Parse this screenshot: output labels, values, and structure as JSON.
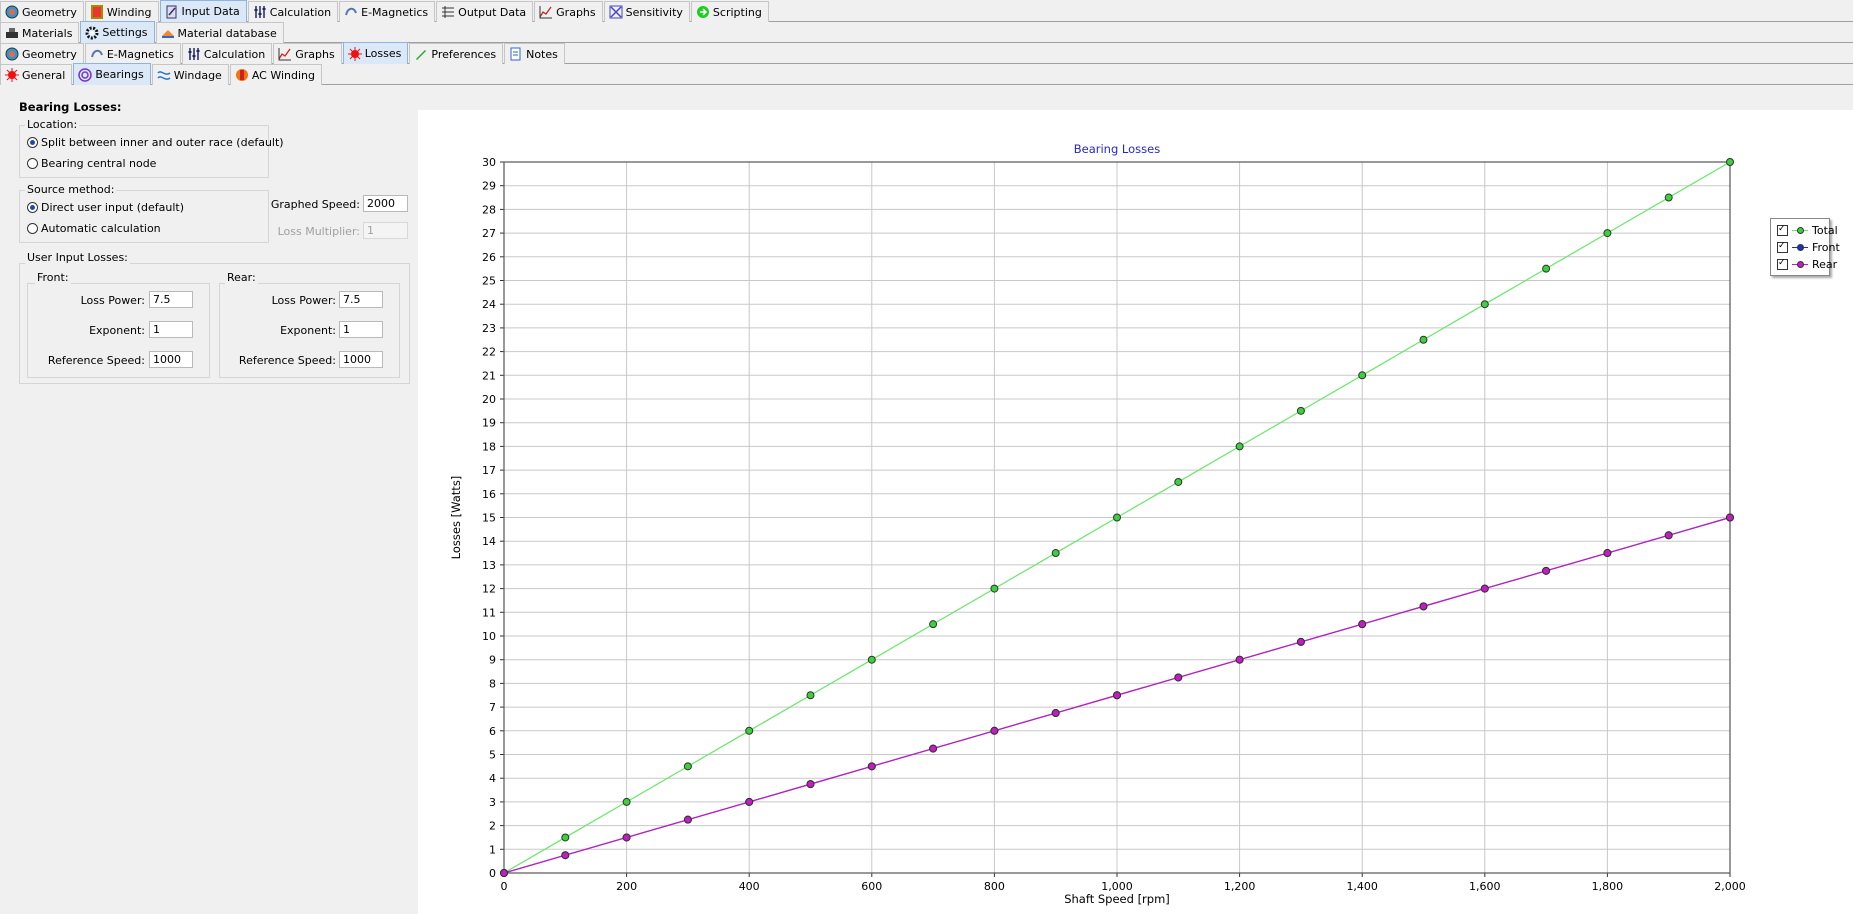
{
  "main_tabs": [
    {
      "label": "Geometry",
      "icon": "geometry-icon",
      "selected": false
    },
    {
      "label": "Winding",
      "icon": "winding-icon",
      "selected": false
    },
    {
      "label": "Input Data",
      "icon": "input-data-icon",
      "selected": true
    },
    {
      "label": "Calculation",
      "icon": "calculation-icon",
      "selected": false
    },
    {
      "label": "E-Magnetics",
      "icon": "emagnetics-icon",
      "selected": false
    },
    {
      "label": "Output Data",
      "icon": "output-data-icon",
      "selected": false
    },
    {
      "label": "Graphs",
      "icon": "graphs-icon",
      "selected": false
    },
    {
      "label": "Sensitivity",
      "icon": "sensitivity-icon",
      "selected": false
    },
    {
      "label": "Scripting",
      "icon": "scripting-icon",
      "selected": false
    }
  ],
  "sub_tabs": [
    {
      "label": "Materials",
      "icon": "materials-icon",
      "selected": false
    },
    {
      "label": "Settings",
      "icon": "settings-icon",
      "selected": true
    },
    {
      "label": "Material database",
      "icon": "material-database-icon",
      "selected": false
    }
  ],
  "settings_tabs": [
    {
      "label": "Geometry",
      "icon": "geometry-icon",
      "selected": false
    },
    {
      "label": "E-Magnetics",
      "icon": "emagnetics-icon",
      "selected": false
    },
    {
      "label": "Calculation",
      "icon": "calculation-icon",
      "selected": false
    },
    {
      "label": "Graphs",
      "icon": "graphs-icon",
      "selected": false
    },
    {
      "label": "Losses",
      "icon": "losses-icon",
      "selected": true
    },
    {
      "label": "Preferences",
      "icon": "preferences-icon",
      "selected": false
    },
    {
      "label": "Notes",
      "icon": "notes-icon",
      "selected": false
    }
  ],
  "loss_tabs": [
    {
      "label": "General",
      "icon": "general-icon",
      "selected": false
    },
    {
      "label": "Bearings",
      "icon": "bearings-icon",
      "selected": true
    },
    {
      "label": "Windage",
      "icon": "windage-icon",
      "selected": false
    },
    {
      "label": "AC Winding",
      "icon": "ac-winding-icon",
      "selected": false
    }
  ],
  "panel": {
    "title": "Bearing Losses:",
    "location": {
      "title": "Location:",
      "options": [
        "Split between inner and outer race (default)",
        "Bearing central node"
      ],
      "selected": 0
    },
    "source": {
      "title": "Source method:",
      "options": [
        "Direct user input (default)",
        "Automatic calculation"
      ],
      "selected": 0
    },
    "graphed_speed": {
      "label": "Graphed Speed:",
      "value": "2000"
    },
    "loss_multiplier": {
      "label": "Loss Multiplier:",
      "value": "1"
    },
    "user_input": {
      "title": "User Input Losses:",
      "front": {
        "title": "Front:",
        "loss_power_label": "Loss Power:",
        "loss_power": "7.5",
        "exponent_label": "Exponent:",
        "exponent": "1",
        "ref_speed_label": "Reference Speed:",
        "ref_speed": "1000"
      },
      "rear": {
        "title": "Rear:",
        "loss_power_label": "Loss Power:",
        "loss_power": "7.5",
        "exponent_label": "Exponent:",
        "exponent": "1",
        "ref_speed_label": "Reference Speed:",
        "ref_speed": "1000"
      }
    }
  },
  "chart_data": {
    "type": "line",
    "title": "Bearing Losses",
    "xlabel": "Shaft Speed [rpm]",
    "ylabel": "Losses [Watts]",
    "xlim": [
      0,
      2000
    ],
    "ylim": [
      0,
      30
    ],
    "x_ticks": [
      0,
      200,
      400,
      600,
      800,
      1000,
      1200,
      1400,
      1600,
      1800,
      2000
    ],
    "x_tick_labels": [
      "0",
      "200",
      "400",
      "600",
      "800",
      "1,000",
      "1,200",
      "1,400",
      "1,600",
      "1,800",
      "2,000"
    ],
    "y_ticks": [
      0,
      1,
      2,
      3,
      4,
      5,
      6,
      7,
      8,
      9,
      10,
      11,
      12,
      13,
      14,
      15,
      16,
      17,
      18,
      19,
      20,
      21,
      22,
      23,
      24,
      25,
      26,
      27,
      28,
      29,
      30
    ],
    "grid": true,
    "legend_position": "right",
    "x": [
      0,
      100,
      200,
      300,
      400,
      500,
      600,
      700,
      800,
      900,
      1000,
      1100,
      1200,
      1300,
      1400,
      1500,
      1600,
      1700,
      1800,
      1900,
      2000
    ],
    "series": [
      {
        "name": "Total",
        "color": "#3ad13a",
        "line_color": "#66e866",
        "checked": true,
        "values": [
          0,
          1.5,
          3,
          4.5,
          6,
          7.5,
          9,
          10.5,
          12,
          13.5,
          15,
          16.5,
          18,
          19.5,
          21,
          22.5,
          24,
          25.5,
          27,
          28.5,
          30
        ]
      },
      {
        "name": "Front",
        "color": "#1c2fc2",
        "line_color": "#1c2fc2",
        "checked": true,
        "values": [
          0,
          0.75,
          1.5,
          2.25,
          3,
          3.75,
          4.5,
          5.25,
          6,
          6.75,
          7.5,
          8.25,
          9,
          9.75,
          10.5,
          11.25,
          12,
          12.75,
          13.5,
          14.25,
          15
        ]
      },
      {
        "name": "Rear",
        "color": "#c21cc2",
        "line_color": "#c21cc2",
        "checked": true,
        "values": [
          0,
          0.75,
          1.5,
          2.25,
          3,
          3.75,
          4.5,
          5.25,
          6,
          6.75,
          7.5,
          8.25,
          9,
          9.75,
          10.5,
          11.25,
          12,
          12.75,
          13.5,
          14.25,
          15
        ]
      }
    ],
    "title_color": "#2727c8"
  }
}
